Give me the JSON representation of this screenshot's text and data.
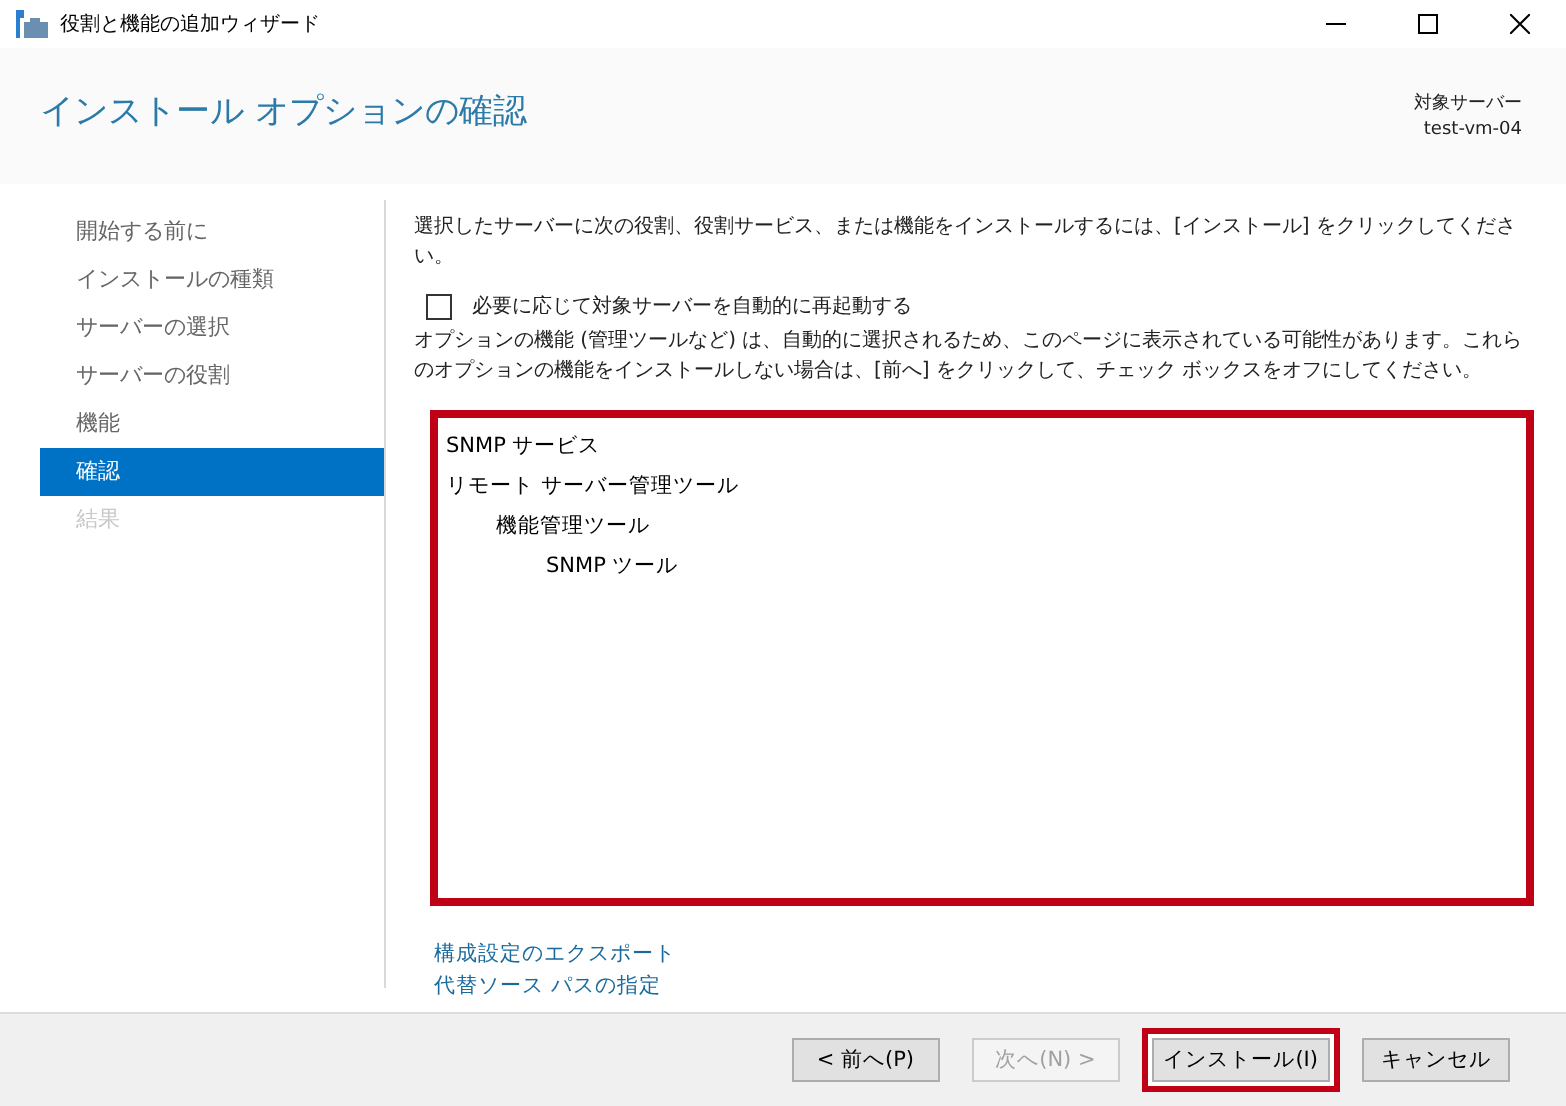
{
  "window": {
    "title": "役割と機能の追加ウィザード"
  },
  "header": {
    "title": "インストール オプションの確認",
    "server_label": "対象サーバー",
    "server_name": "test-vm-04"
  },
  "steps": [
    {
      "label": "開始する前に",
      "selected": false,
      "disabled": false
    },
    {
      "label": "インストールの種類",
      "selected": false,
      "disabled": false
    },
    {
      "label": "サーバーの選択",
      "selected": false,
      "disabled": false
    },
    {
      "label": "サーバーの役割",
      "selected": false,
      "disabled": false
    },
    {
      "label": "機能",
      "selected": false,
      "disabled": false
    },
    {
      "label": "確認",
      "selected": true,
      "disabled": false
    },
    {
      "label": "結果",
      "selected": false,
      "disabled": true
    }
  ],
  "intro": "選択したサーバーに次の役割、役割サービス、または機能をインストールするには、[インストール] をクリックしてください。",
  "restart_checkbox": {
    "label": "必要に応じて対象サーバーを自動的に再起動する",
    "checked": false
  },
  "note": "オプションの機能 (管理ツールなど) は、自動的に選択されるため、このページに表示されている可能性があります。これらのオプションの機能をインストールしない場合は、[前へ] をクリックして、チェック ボックスをオフにしてください。",
  "selection_list": {
    "highlighted": true,
    "items": [
      {
        "label": "SNMP サービス"
      },
      {
        "label": "リモート サーバー管理ツール",
        "children": [
          {
            "label": "機能管理ツール",
            "children": [
              {
                "label": "SNMP ツール"
              }
            ]
          }
        ]
      }
    ]
  },
  "links": [
    "構成設定のエクスポート",
    "代替ソース パスの指定"
  ],
  "buttons": [
    {
      "label": "< 前へ(P)",
      "disabled": false,
      "highlighted": false
    },
    {
      "label": "次へ(N) >",
      "disabled": true,
      "highlighted": false
    },
    {
      "label": "インストール(I)",
      "disabled": false,
      "highlighted": true
    },
    {
      "label": "キャンセル",
      "disabled": false,
      "highlighted": false
    }
  ]
}
